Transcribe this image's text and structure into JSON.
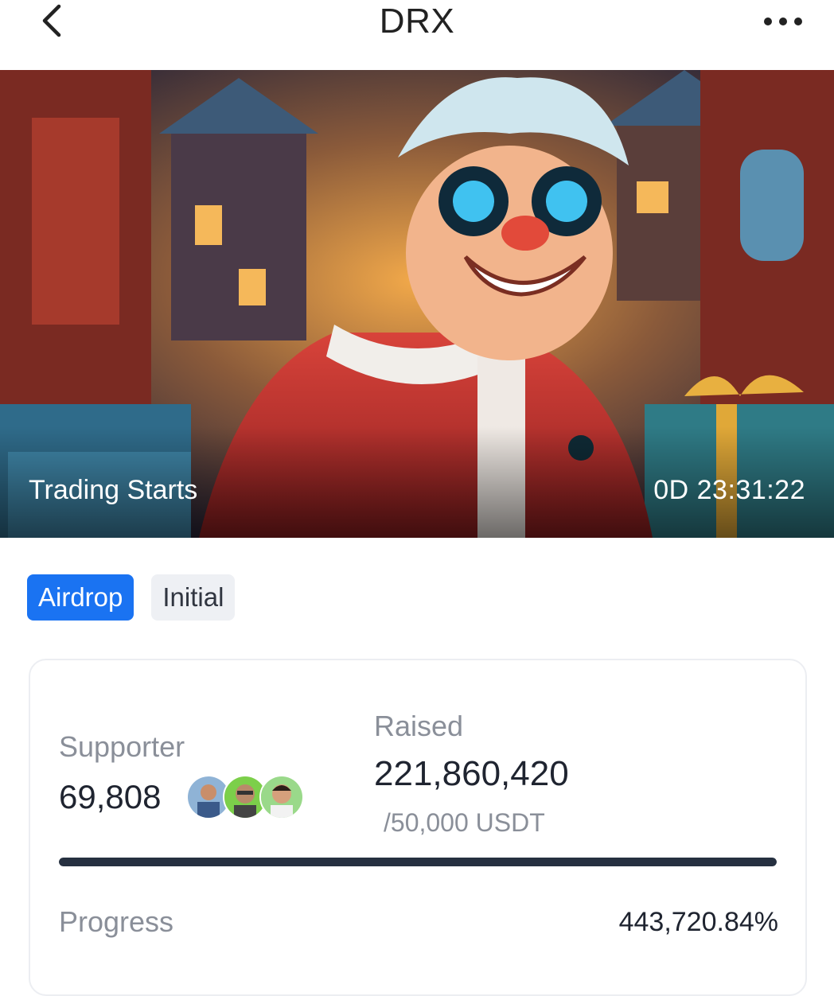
{
  "header": {
    "title": "DRX",
    "back_icon": "chevron-left-icon",
    "more_icon": "more-horizontal-icon"
  },
  "banner": {
    "status_label": "Trading Starts",
    "countdown": "0D 23:31:22"
  },
  "tabs": [
    {
      "label": "Airdrop",
      "active": true
    },
    {
      "label": "Initial",
      "active": false
    }
  ],
  "stats": {
    "supporter_label": "Supporter",
    "supporter_value": "69,808",
    "raised_label": "Raised",
    "raised_value": "221,860,420",
    "raised_target": "/50,000 USDT",
    "progress_label": "Progress",
    "progress_value": "443,720.84%",
    "progress_fill_percent": 100
  },
  "colors": {
    "accent": "#1a73f2",
    "progress_fill": "#263040",
    "muted_text": "#8a8f99"
  }
}
